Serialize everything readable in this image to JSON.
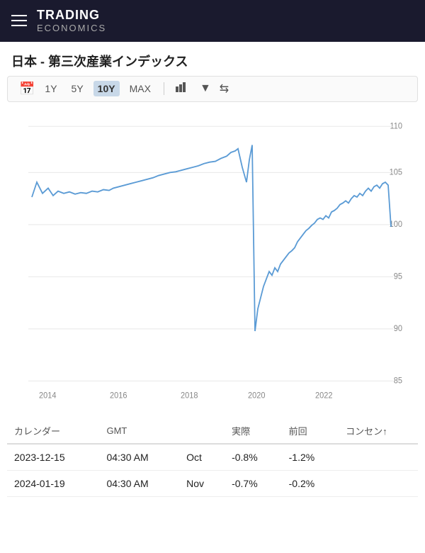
{
  "header": {
    "title": "TRADING",
    "subtitle": "ECONOMICS",
    "menu_icon": "☰"
  },
  "page": {
    "title": "日本 - 第三次産業インデックス"
  },
  "toolbar": {
    "calendar_icon": "📅",
    "buttons": [
      "1Y",
      "5Y",
      "10Y",
      "MAX"
    ],
    "active_button": "10Y",
    "chart_icon": "📊",
    "dropdown_icon": "▼",
    "shuffle_icon": "⇌"
  },
  "chart": {
    "y_axis_labels": [
      "110",
      "105",
      "100",
      "95",
      "90",
      "85"
    ],
    "x_axis_labels": [
      "2014",
      "2016",
      "2018",
      "2020",
      "2022"
    ],
    "line_color": "#5b9bd5"
  },
  "table": {
    "columns": [
      "カレンダー",
      "GMT",
      "",
      "実際",
      "前回",
      "コンセン↑"
    ],
    "rows": [
      {
        "date": "2023-12-15",
        "gmt": "04:30 AM",
        "period": "Oct",
        "actual": "-0.8%",
        "previous": "-1.2%",
        "consensus": ""
      },
      {
        "date": "2024-01-19",
        "gmt": "04:30 AM",
        "period": "Nov",
        "actual": "-0.7%",
        "previous": "-0.2%",
        "consensus": ""
      }
    ]
  }
}
